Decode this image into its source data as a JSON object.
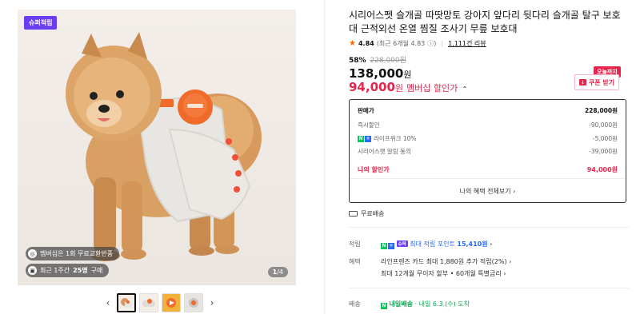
{
  "gallery": {
    "badge": "슈퍼적립",
    "pill_return": "멤버십은 1회 무료교환반품",
    "pill_sales_prefix": "최근 1주간",
    "pill_sales_count": "25명",
    "pill_sales_suffix": "구매",
    "counter_current": "1",
    "counter_total": "/4",
    "prev_arrow": "‹",
    "next_arrow": "›",
    "thumbnails": [
      "thumb-1",
      "thumb-2",
      "thumb-3",
      "thumb-4"
    ]
  },
  "product": {
    "title": "시리어스펫 슬개골 따땃망토 강아지 앞다리 뒷다리 슬개골 탈구 보호대 근적외선 온열 찜질 조사기 무릎 보호대",
    "rating_score": "4.84",
    "rating_detail": "(최근 6개월 4.83",
    "rating_info": "ⓘ)",
    "reviews": "1,111건 리뷰",
    "discount_rate": "58%",
    "original_price": "228,000원",
    "price_value": "138,000",
    "price_unit": "원",
    "member_price_value": "94,000",
    "member_price_unit": "원",
    "member_label": "멤버십 할인가",
    "member_chevron": "⌃"
  },
  "coupon": {
    "today_tag": "오늘까지",
    "button_label": "쿠폰 받기"
  },
  "price_box": {
    "sale_label": "판매가",
    "sale_value": "228,000원",
    "instant_label": "즉시할인",
    "instant_value": "-90,000원",
    "lifeplus_label": "라이프위크 10%",
    "lifeplus_value": "-5,000원",
    "alert_label": "시리어스펫 알림 동의",
    "alert_value": "-39,000원",
    "mine_label": "나의 할인가",
    "mine_value": "94,000원",
    "all_benefits": "나의 혜택 전체보기 ›"
  },
  "shipping_free": "무료배송",
  "info": {
    "points_key": "적립",
    "points_prefix": "최대 적립 포인트",
    "points_value": "15,410원",
    "points_chevron": "›",
    "benefit_key": "혜택",
    "benefit_line1": "라인프렌즈 카드 최대 1,880원 추가 적립(2%) ›",
    "benefit_line2": "최대 12개월 무이자 할부 • 60개월 특별금리 ›",
    "delivery_key": "배송",
    "delivery_fast": "내일배송",
    "delivery_rest": "· 내일 6.3.(수) 도착"
  },
  "colors": {
    "accent_red": "#e5254b",
    "super_purple": "#6a3df0",
    "naver_green": "#03c75a",
    "plus_blue": "#2b6af6",
    "star_orange": "#ff6a00"
  }
}
